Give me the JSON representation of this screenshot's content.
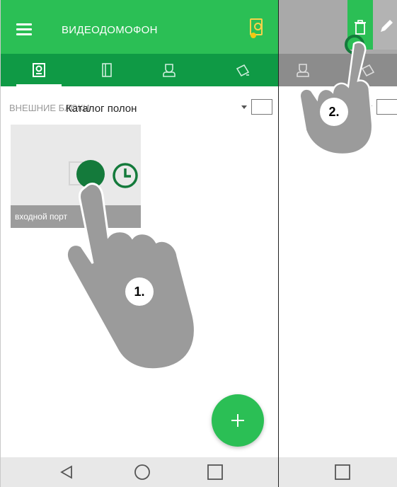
{
  "screen1": {
    "app_title": "ВИДЕОДОМОФОН",
    "tabs": [
      "intercom-tab",
      "door-tab",
      "guard-tab",
      "camera-tab"
    ],
    "section_label": "ВНЕШНИЕ БЛОКИ",
    "overlay_label": "Каталог полон",
    "card_caption": "входной порт",
    "step_label": "1."
  },
  "screen2": {
    "step_label": "2."
  },
  "colors": {
    "appbar": "#2bbf55",
    "tabbar": "#0f9a45",
    "accent_dark": "#147a3b",
    "notification_dot": "#f2c811"
  }
}
